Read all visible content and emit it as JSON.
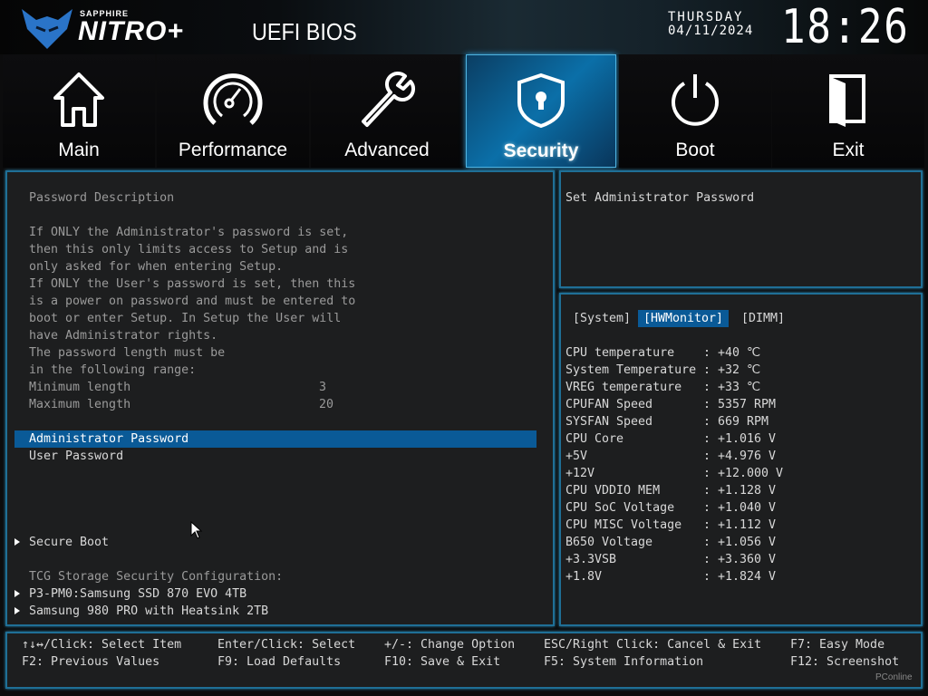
{
  "header": {
    "brand_small": "SAPPHIRE",
    "brand": "NITRO+",
    "title": "UEFI BIOS",
    "day": "THURSDAY",
    "date": "04/11/2024",
    "time": "18:26"
  },
  "tabs": [
    {
      "label": "Main",
      "icon": "home-icon"
    },
    {
      "label": "Performance",
      "icon": "speedometer-icon"
    },
    {
      "label": "Advanced",
      "icon": "wrench-icon"
    },
    {
      "label": "Security",
      "icon": "shield-lock-icon",
      "active": true
    },
    {
      "label": "Boot",
      "icon": "power-icon"
    },
    {
      "label": "Exit",
      "icon": "door-exit-icon"
    }
  ],
  "left": {
    "title": "Password Description",
    "description": [
      "If ONLY the Administrator's password is set,",
      "then this only limits access to Setup and is",
      "only asked for when entering Setup.",
      "If ONLY the User's password is set, then this",
      "is a power on password and must be entered to",
      "boot or enter Setup. In Setup the User will",
      "have Administrator rights.",
      "The password length must be",
      "in the following range:"
    ],
    "min_label": "Minimum length",
    "min_value": "3",
    "max_label": "Maximum length",
    "max_value": "20",
    "admin_password": "Administrator Password",
    "user_password": "User Password",
    "secure_boot": "Secure Boot",
    "tcg_label": "TCG Storage Security Configuration:",
    "drives": [
      "P3-PM0:Samsung SSD 870 EVO 4TB",
      "Samsung 980 PRO with Heatsink 2TB"
    ]
  },
  "help": {
    "text": "Set Administrator Password"
  },
  "monitor": {
    "tabs": [
      "[System]",
      "[HWMonitor]",
      "[DIMM]"
    ],
    "rows": [
      {
        "k": "CPU temperature",
        "v": ": +40 ℃"
      },
      {
        "k": "System Temperature",
        "v": ": +32 ℃"
      },
      {
        "k": "VREG temperature",
        "v": ": +33 ℃"
      },
      {
        "k": "CPUFAN Speed",
        "v": ": 5357 RPM"
      },
      {
        "k": "SYSFAN Speed",
        "v": ": 669 RPM"
      },
      {
        "k": "CPU Core",
        "v": ": +1.016 V"
      },
      {
        "k": "+5V",
        "v": ": +4.976 V"
      },
      {
        "k": "+12V",
        "v": ": +12.000 V"
      },
      {
        "k": "CPU VDDIO MEM",
        "v": ": +1.128 V"
      },
      {
        "k": "CPU SoC Voltage",
        "v": ": +1.040 V"
      },
      {
        "k": "CPU MISC Voltage",
        "v": ": +1.112 V"
      },
      {
        "k": "B650 Voltage",
        "v": ": +1.056 V"
      },
      {
        "k": "+3.3VSB",
        "v": ": +3.360 V"
      },
      {
        "k": "+1.8V",
        "v": ": +1.824 V"
      }
    ]
  },
  "footer": {
    "keys": [
      "↑↓↔/Click: Select Item",
      "Enter/Click: Select",
      "+/-: Change Option",
      "ESC/Right Click: Cancel & Exit",
      "F7: Easy Mode",
      "F2: Previous Values",
      "F9: Load Defaults",
      "F10: Save & Exit",
      "F5: System Information",
      "F12: Screenshot"
    ],
    "watermark": "PConline"
  },
  "colors": {
    "accent": "#0a5a97",
    "border": "#1f6f96"
  }
}
